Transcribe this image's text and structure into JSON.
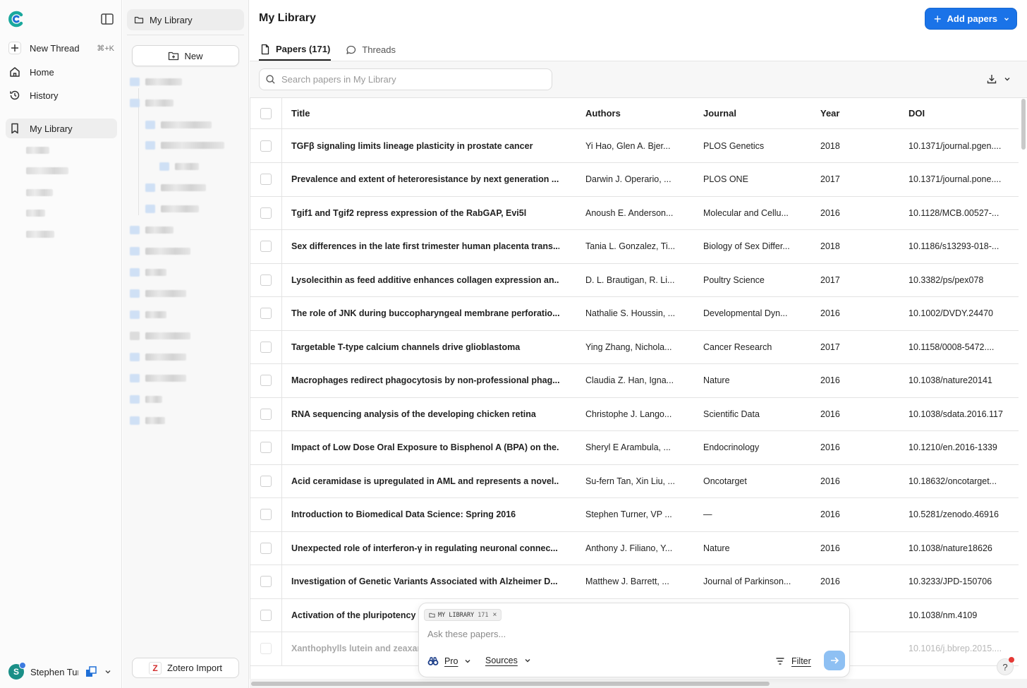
{
  "sidebar": {
    "new_thread": "New Thread",
    "new_thread_shortcut": "⌘+K",
    "home": "Home",
    "history": "History",
    "my_library": "My Library",
    "user_name": "Stephen Turner"
  },
  "library_panel": {
    "header": "My Library",
    "new_label": "New",
    "zotero_label": "Zotero Import"
  },
  "main": {
    "title": "My Library",
    "add_papers": "Add papers",
    "tabs": [
      {
        "label": "Papers (171)",
        "icon": "document-icon",
        "active": true
      },
      {
        "label": "Threads",
        "icon": "chat-bubble-icon",
        "active": false
      }
    ],
    "search_placeholder": "Search papers in My Library"
  },
  "table": {
    "columns": [
      "Title",
      "Authors",
      "Journal",
      "Year",
      "DOI"
    ],
    "rows": [
      {
        "title": "TGFβ signaling limits lineage plasticity in prostate cancer",
        "authors": "Yi Hao, Glen A. Bjer...",
        "journal": "PLOS Genetics",
        "year": "2018",
        "doi": "10.1371/journal.pgen...."
      },
      {
        "title": "Prevalence and extent of heteroresistance by next generation ...",
        "authors": "Darwin J. Operario, ...",
        "journal": "PLOS ONE",
        "year": "2017",
        "doi": "10.1371/journal.pone...."
      },
      {
        "title": "Tgif1 and Tgif2 repress expression of the RabGAP, Evi5l",
        "authors": "Anoush E. Anderson...",
        "journal": "Molecular and Cellu...",
        "year": "2016",
        "doi": "10.1128/MCB.00527-..."
      },
      {
        "title": "Sex differences in the late first trimester human placenta trans...",
        "authors": "Tania L. Gonzalez, Ti...",
        "journal": "Biology of Sex Differ...",
        "year": "2018",
        "doi": "10.1186/s13293-018-..."
      },
      {
        "title": "Lysolecithin as feed additive enhances collagen expression an...",
        "authors": "D. L. Brautigan, R. Li...",
        "journal": "Poultry Science",
        "year": "2017",
        "doi": "10.3382/ps/pex078"
      },
      {
        "title": "The role of JNK during buccopharyngeal membrane perforatio...",
        "authors": "Nathalie S. Houssin, ...",
        "journal": "Developmental Dyn...",
        "year": "2016",
        "doi": "10.1002/DVDY.24470"
      },
      {
        "title": "Targetable T-type calcium channels drive glioblastoma",
        "authors": "Ying Zhang, Nichola...",
        "journal": "Cancer Research",
        "year": "2017",
        "doi": "10.1158/0008-5472...."
      },
      {
        "title": "Macrophages redirect phagocytosis by non-professional phag...",
        "authors": "Claudia Z. Han, Igna...",
        "journal": "Nature",
        "year": "2016",
        "doi": "10.1038/nature20141"
      },
      {
        "title": "RNA sequencing analysis of the developing chicken retina",
        "authors": "Christophe J. Lango...",
        "journal": "Scientific Data",
        "year": "2016",
        "doi": "10.1038/sdata.2016.117"
      },
      {
        "title": "Impact of Low Dose Oral Exposure to Bisphenol A (BPA) on the...",
        "authors": "Sheryl E Arambula, ...",
        "journal": "Endocrinology",
        "year": "2016",
        "doi": "10.1210/en.2016-1339"
      },
      {
        "title": "Acid ceramidase is upregulated in AML and represents a novel...",
        "authors": "Su-fern Tan, Xin Liu, ...",
        "journal": "Oncotarget",
        "year": "2016",
        "doi": "10.18632/oncotarget..."
      },
      {
        "title": "Introduction to Biomedical Data Science: Spring 2016",
        "authors": "Stephen Turner, VP ...",
        "journal": "—",
        "year": "2016",
        "doi": "10.5281/zenodo.46916"
      },
      {
        "title": "Unexpected role of interferon-γ in regulating neuronal connec...",
        "authors": "Anthony J. Filiano, Y...",
        "journal": "Nature",
        "year": "2016",
        "doi": "10.1038/nature18626"
      },
      {
        "title": "Investigation of Genetic Variants Associated with Alzheimer D...",
        "authors": "Matthew J. Barrett, ...",
        "journal": "Journal of Parkinson...",
        "year": "2016",
        "doi": "10.3233/JPD-150706"
      },
      {
        "title": "Activation of the pluripotency",
        "authors": "",
        "journal": "",
        "year": "",
        "doi": "10.1038/nm.4109"
      },
      {
        "title": "Xanthophylls lutein and zeaxan",
        "authors": "",
        "journal": "",
        "year": "",
        "doi": "10.1016/j.bbrep.2015...."
      }
    ]
  },
  "chat": {
    "chip_label": "MY LIBRARY",
    "chip_count": "171",
    "chip_close": "×",
    "placeholder": "Ask these papers...",
    "mode": "Pro",
    "sources": "Sources",
    "filter": "Filter"
  },
  "help_label": "?",
  "colors": {
    "accent": "#1a73e8",
    "brand": "#1a8f87"
  }
}
